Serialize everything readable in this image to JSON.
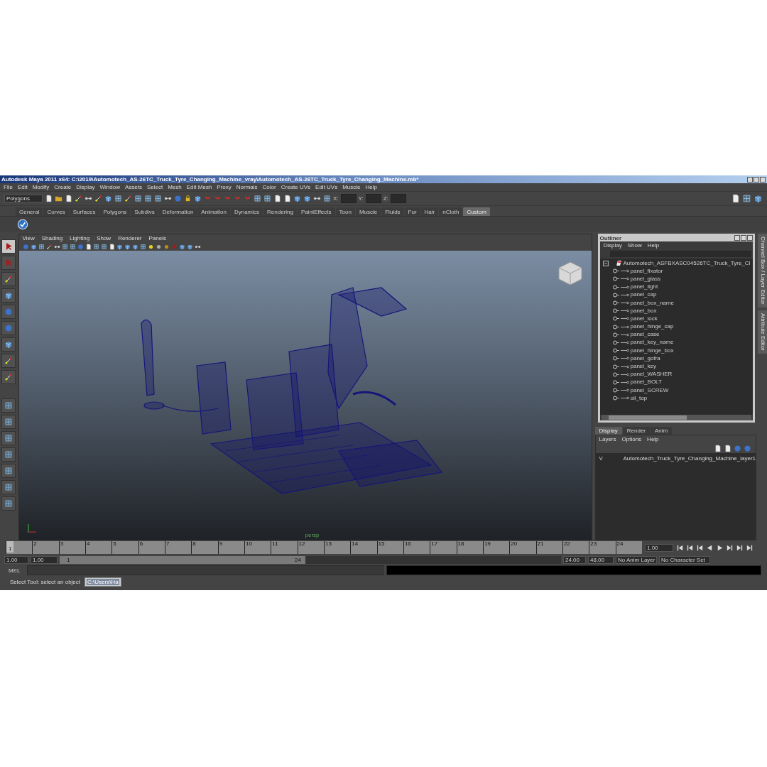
{
  "window": {
    "title": "Autodesk Maya 2011 x64: C:\\2019\\Automotech_AS-26TC_Truck_Tyre_Changing_Machine_vray\\Automotech_AS-26TC_Truck_Tyre_Changing_Machine.mb*"
  },
  "menu_bar": [
    "File",
    "Edit",
    "Modify",
    "Create",
    "Display",
    "Window",
    "Assets",
    "Select",
    "Mesh",
    "Edit Mesh",
    "Proxy",
    "Normals",
    "Color",
    "Create UVs",
    "Edit UVs",
    "Muscle",
    "Help"
  ],
  "status_line": {
    "mode": "Polygons",
    "fields": [
      {
        "label": "X:"
      },
      {
        "label": "Y:"
      },
      {
        "label": "Z:"
      }
    ]
  },
  "shelf_tabs": [
    {
      "label": "General",
      "selected": false
    },
    {
      "label": "Curves",
      "selected": false
    },
    {
      "label": "Surfaces",
      "selected": false
    },
    {
      "label": "Polygons",
      "selected": false
    },
    {
      "label": "Subdivs",
      "selected": false
    },
    {
      "label": "Deformation",
      "selected": false
    },
    {
      "label": "Animation",
      "selected": false
    },
    {
      "label": "Dynamics",
      "selected": false
    },
    {
      "label": "Rendering",
      "selected": false
    },
    {
      "label": "PaintEffects",
      "selected": false
    },
    {
      "label": "Toon",
      "selected": false
    },
    {
      "label": "Muscle",
      "selected": false
    },
    {
      "label": "Fluids",
      "selected": false
    },
    {
      "label": "Fur",
      "selected": false
    },
    {
      "label": "Hair",
      "selected": false
    },
    {
      "label": "nCloth",
      "selected": false
    },
    {
      "label": "Custom",
      "selected": true
    }
  ],
  "viewport": {
    "menu": [
      "View",
      "Shading",
      "Lighting",
      "Show",
      "Renderer",
      "Panels"
    ],
    "camera_label": "persp"
  },
  "outliner": {
    "title": "Outliner",
    "menu": [
      "Display",
      "Show",
      "Help"
    ],
    "root": {
      "label": "Automotech_ASFBXASC04526TC_Truck_Tyre_Cl",
      "expanded": true,
      "children": [
        {
          "label": "panel_fixator"
        },
        {
          "label": "panel_glass"
        },
        {
          "label": "panel_light"
        },
        {
          "label": "panel_cap"
        },
        {
          "label": "panel_box_name"
        },
        {
          "label": "panel_box"
        },
        {
          "label": "panel_lock"
        },
        {
          "label": "panel_hinge_cap"
        },
        {
          "label": "panel_case"
        },
        {
          "label": "panel_key_name"
        },
        {
          "label": "panel_hinge_box"
        },
        {
          "label": "panel_gofra"
        },
        {
          "label": "panel_key"
        },
        {
          "label": "panel_WASHER"
        },
        {
          "label": "panel_BOLT"
        },
        {
          "label": "panel_SCREW"
        },
        {
          "label": "oil_top"
        }
      ]
    }
  },
  "layer_editor": {
    "tabs": [
      {
        "label": "Display",
        "selected": true
      },
      {
        "label": "Render",
        "selected": false
      },
      {
        "label": "Anim",
        "selected": false
      }
    ],
    "menu": [
      "Layers",
      "Options",
      "Help"
    ],
    "layers": [
      {
        "visibility": "V",
        "name": "Automotech_Truck_Tyre_Changing_Machine_layer1"
      }
    ]
  },
  "side_tabs": [
    "Channel Box / Layer Editor",
    "Attribute Editor"
  ],
  "time_slider": {
    "ticks": [
      "1",
      "2",
      "3",
      "4",
      "5",
      "6",
      "7",
      "8",
      "9",
      "10",
      "11",
      "12",
      "13",
      "14",
      "15",
      "16",
      "17",
      "18",
      "19",
      "20",
      "21",
      "22",
      "23",
      "24"
    ],
    "current_frame": "1.00"
  },
  "range_slider": {
    "level": 0.49,
    "start_time": "1.00",
    "playback_start": "1.00",
    "range_start": "1",
    "range_end": "24",
    "playback_end": "24.00",
    "end_time": "48.00",
    "anim_layer": "No Anim Layer",
    "character_set": "No Character Set"
  },
  "command_line": {
    "label": "MEL"
  },
  "help_line": {
    "text": "Select Tool: select an object",
    "task": "C:\\Users\\Ha"
  }
}
